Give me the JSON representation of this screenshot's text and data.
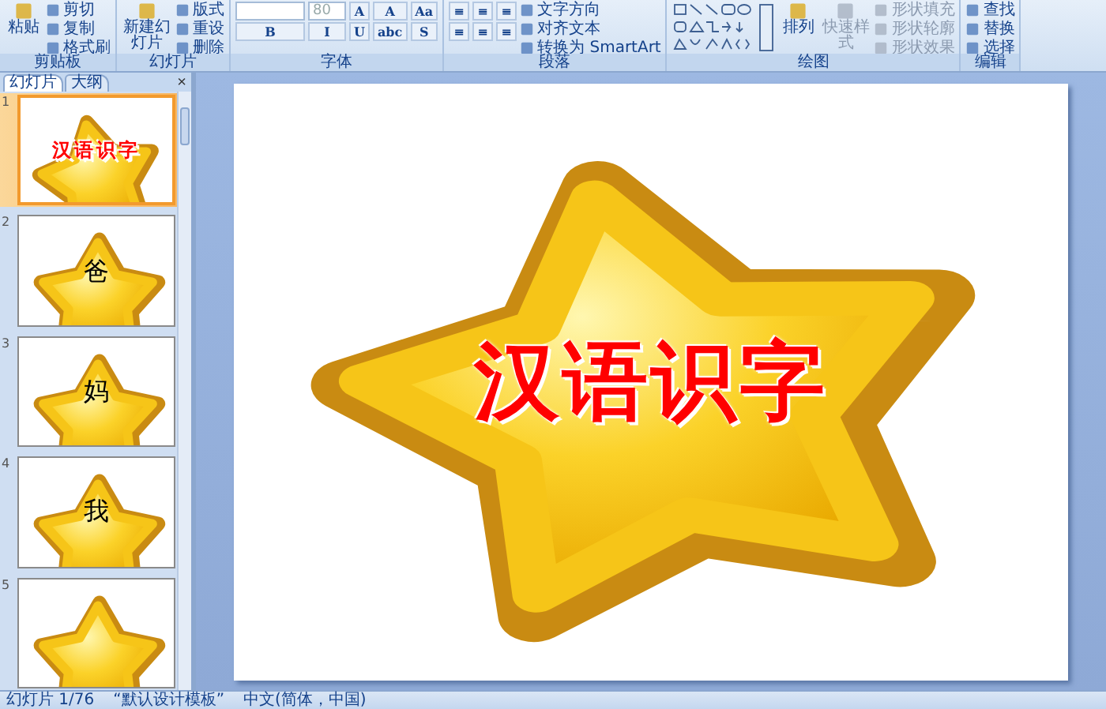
{
  "ribbon": {
    "groups": [
      {
        "label": "剪贴板",
        "columns": [
          [
            {
              "kind": "large",
              "label": "粘贴"
            }
          ],
          [
            {
              "kind": "small",
              "label": "剪切"
            },
            {
              "kind": "small",
              "label": "复制"
            },
            {
              "kind": "small",
              "label": "格式刷"
            }
          ]
        ]
      },
      {
        "label": "幻灯片",
        "columns": [
          [
            {
              "kind": "large",
              "label": "新建幻灯片"
            }
          ],
          [
            {
              "kind": "small",
              "label": "版式"
            },
            {
              "kind": "small",
              "label": "重设"
            },
            {
              "kind": "small",
              "label": "删除"
            }
          ]
        ]
      },
      {
        "label": "字体",
        "columns": [
          [
            {
              "kind": "field"
            },
            {
              "kind": "tool",
              "glyph": "B"
            }
          ],
          [
            {
              "kind": "field",
              "value": "80"
            },
            {
              "kind": "tool",
              "glyph": "I"
            }
          ],
          [
            {
              "kind": "tool",
              "glyph": "A"
            },
            {
              "kind": "tool",
              "glyph": "U"
            }
          ],
          [
            {
              "kind": "tool",
              "glyph": "A"
            },
            {
              "kind": "tool",
              "glyph": "abc"
            }
          ],
          [
            {
              "kind": "tool",
              "glyph": "Aa"
            },
            {
              "kind": "tool",
              "glyph": "S"
            }
          ]
        ]
      },
      {
        "label": "段落",
        "columns": [
          [
            {
              "kind": "tool",
              "glyph": "≡"
            },
            {
              "kind": "tool",
              "glyph": "≡"
            }
          ],
          [
            {
              "kind": "tool",
              "glyph": "≡"
            },
            {
              "kind": "tool",
              "glyph": "≡"
            }
          ],
          [
            {
              "kind": "tool",
              "glyph": "≡"
            },
            {
              "kind": "tool",
              "glyph": "≡"
            }
          ],
          [
            {
              "kind": "small",
              "label": "文字方向"
            },
            {
              "kind": "small",
              "label": "对齐文本"
            },
            {
              "kind": "small",
              "label": "转换为 SmartArt"
            }
          ]
        ]
      },
      {
        "label": "绘图",
        "columns": [
          [
            {
              "kind": "gallery"
            }
          ],
          [
            {
              "kind": "large",
              "label": "排列"
            }
          ],
          [
            {
              "kind": "large",
              "label": "快速样式",
              "disabled": true
            }
          ],
          [
            {
              "kind": "small",
              "label": "形状填充",
              "disabled": true
            },
            {
              "kind": "small",
              "label": "形状轮廓",
              "disabled": true
            },
            {
              "kind": "small",
              "label": "形状效果",
              "disabled": true
            }
          ]
        ]
      },
      {
        "label": "编辑",
        "columns": [
          [
            {
              "kind": "small",
              "label": "查找"
            },
            {
              "kind": "small",
              "label": "替换"
            },
            {
              "kind": "small",
              "label": "选择"
            }
          ]
        ]
      }
    ]
  },
  "pane": {
    "tabs": [
      {
        "label": "幻灯片",
        "selected": true
      },
      {
        "label": "大纲",
        "selected": false
      }
    ],
    "close": "×"
  },
  "slides": [
    {
      "number": "1",
      "kind": "title",
      "caption": "汉语识字",
      "selected": true
    },
    {
      "number": "2",
      "kind": "char",
      "caption": "爸",
      "selected": false
    },
    {
      "number": "3",
      "kind": "char",
      "caption": "妈",
      "selected": false
    },
    {
      "number": "4",
      "kind": "char",
      "caption": "我",
      "selected": false
    },
    {
      "number": "5",
      "kind": "char",
      "selected": false
    }
  ],
  "slide": {
    "title": "汉语识字"
  },
  "status_bar": [
    "幻灯片 1/76",
    "“默认设计模板”",
    "中文(简体，中国)"
  ]
}
